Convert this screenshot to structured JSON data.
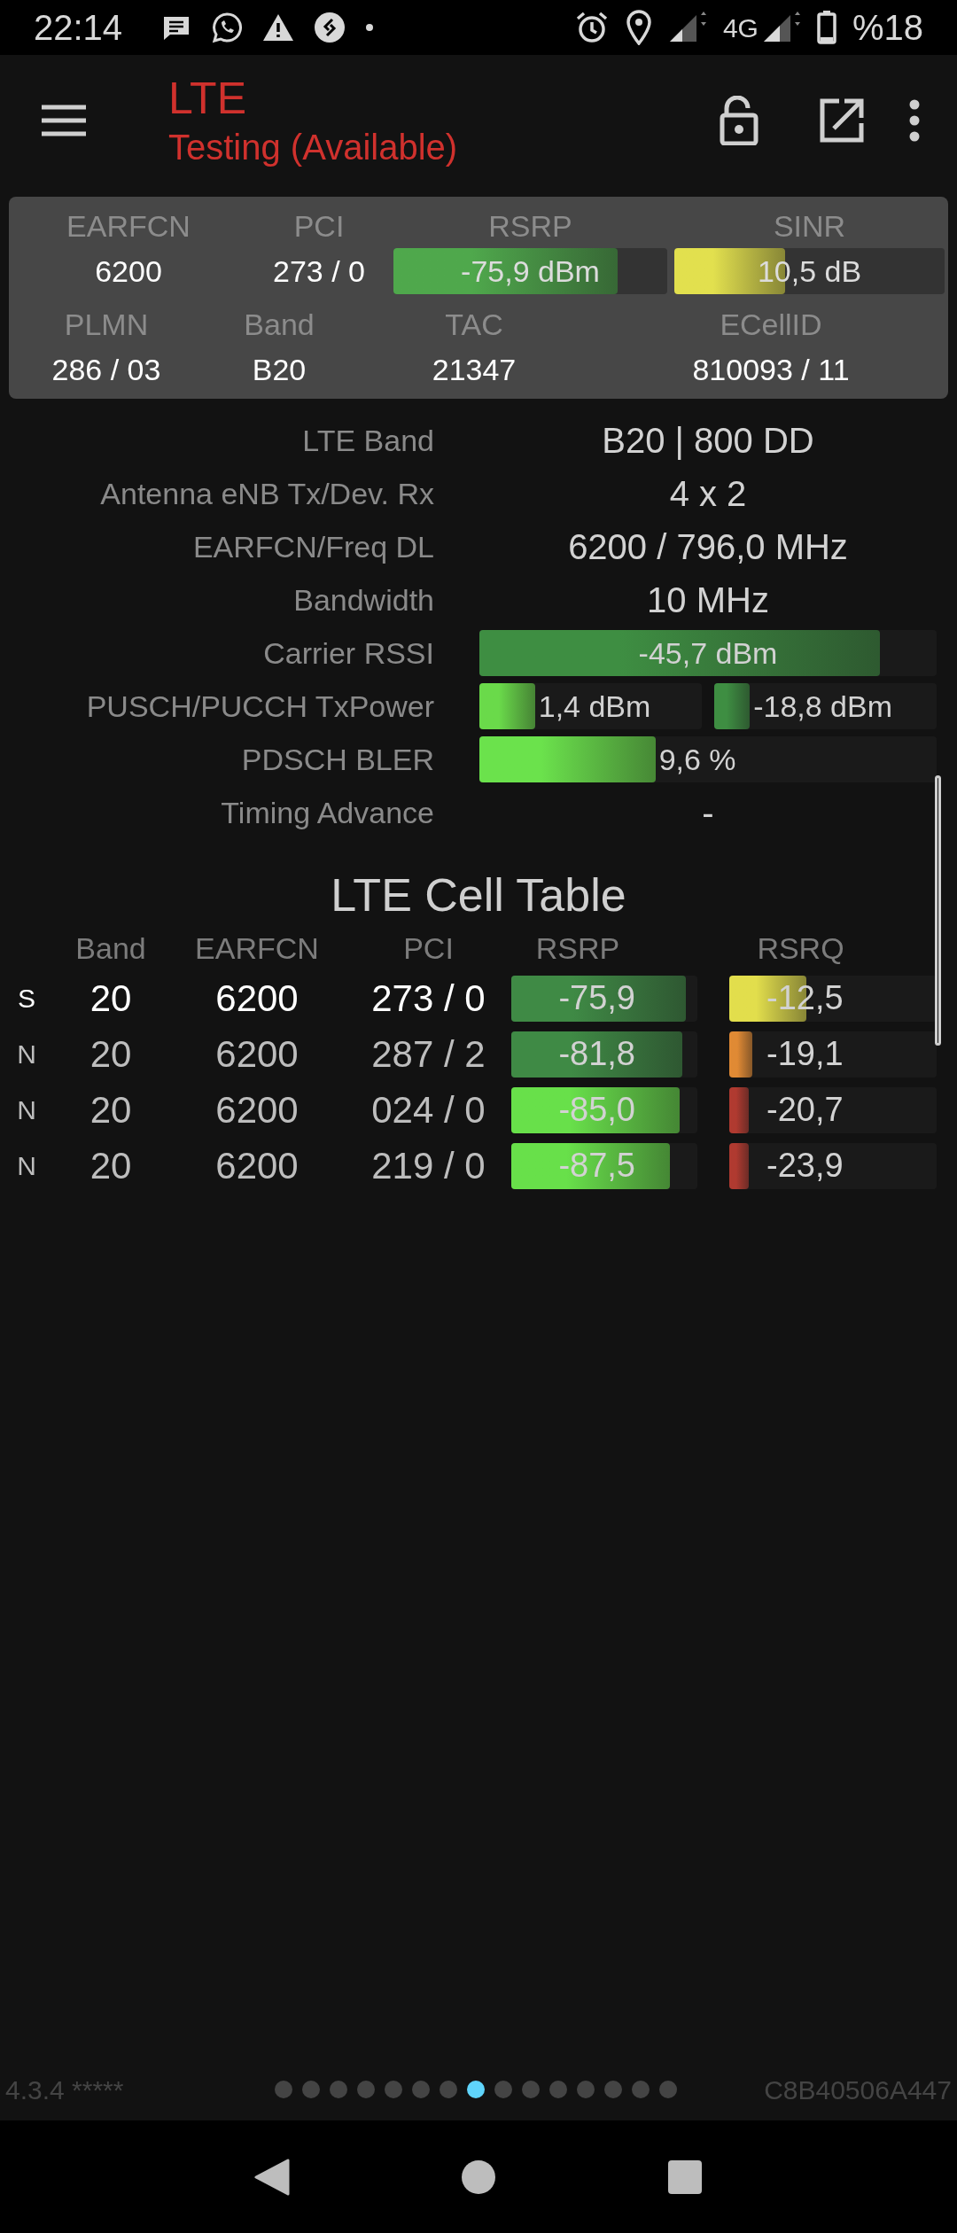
{
  "status_bar": {
    "time": "22:14",
    "network": "4G",
    "battery": "%18"
  },
  "app_bar": {
    "title": "LTE",
    "subtitle": "Testing (Available)"
  },
  "summary": {
    "row1": [
      {
        "label": "EARFCN",
        "value": "6200",
        "kind": "text"
      },
      {
        "label": "PCI",
        "value": "273 / 0",
        "kind": "text"
      },
      {
        "label": "RSRP",
        "value": "-75,9 dBm",
        "kind": "bar",
        "level": 0.82,
        "color": "#4fa84c"
      },
      {
        "label": "SINR",
        "value": "10,5 dB",
        "kind": "bar",
        "level": 0.41,
        "color": "#e2e04e"
      }
    ],
    "row2": [
      {
        "label": "PLMN",
        "value": "286 / 03"
      },
      {
        "label": "Band",
        "value": "B20"
      },
      {
        "label": "TAC",
        "value": "21347"
      },
      {
        "label": "ECellID",
        "value": "810093 / 11"
      }
    ]
  },
  "details": [
    {
      "label": "LTE Band",
      "kind": "text",
      "value": "B20 | 800 DD"
    },
    {
      "label": "Antenna eNB Tx/Dev. Rx",
      "kind": "text",
      "value": "4 x 2"
    },
    {
      "label": "EARFCN/Freq DL",
      "kind": "text",
      "value": "6200 / 796,0 MHz"
    },
    {
      "label": "Bandwidth",
      "kind": "text",
      "value": "10 MHz"
    },
    {
      "label": "Carrier RSSI",
      "kind": "bars",
      "bars": [
        {
          "value": "-45,7 dBm",
          "level": 0.876,
          "color": "#3e8e42",
          "kind": "centered"
        }
      ]
    },
    {
      "label": "PUSCH/PUCCH TxPower",
      "kind": "bars",
      "bars": [
        {
          "value": "1,4 dBm",
          "level": 0.25,
          "color": "#6ada4a",
          "kind": "trailing"
        },
        {
          "value": "-18,8 dBm",
          "level": 0.16,
          "color": "#3e8e42",
          "kind": "trailing"
        }
      ]
    },
    {
      "label": "PDSCH BLER",
      "kind": "bars",
      "bars": [
        {
          "value": "9,6 %",
          "level": 0.385,
          "color": "#6be24c",
          "kind": "trailing"
        }
      ]
    },
    {
      "label": "Timing Advance",
      "kind": "text",
      "value": "-"
    }
  ],
  "cell_table": {
    "title": "LTE Cell Table",
    "columns": [
      "Band",
      "EARFCN",
      "PCI",
      "RSRP",
      "RSRQ"
    ],
    "rows": [
      {
        "type": "S",
        "highlighted": true,
        "band": "20",
        "earfcn": "6200",
        "pci": "273 / 0",
        "rsrp": {
          "value": "-75,9",
          "level": 0.94,
          "color": "#3f8a45"
        },
        "rsrq": {
          "value": "-12,5",
          "level": 0.37,
          "color": "#e2de4c"
        }
      },
      {
        "type": "N",
        "highlighted": false,
        "band": "20",
        "earfcn": "6200",
        "pci": "287 / 2",
        "rsrp": {
          "value": "-81,8",
          "level": 0.92,
          "color": "#3f8a45"
        },
        "rsrq": {
          "value": "-19,1",
          "level": 0.11,
          "color": "#e08a34"
        }
      },
      {
        "type": "N",
        "highlighted": false,
        "band": "20",
        "earfcn": "6200",
        "pci": "024 / 0",
        "rsrp": {
          "value": "-85,0",
          "level": 0.905,
          "color": "#68e04a"
        },
        "rsrq": {
          "value": "-20,7",
          "level": 0.07,
          "color": "#b03a30"
        }
      },
      {
        "type": "N",
        "highlighted": false,
        "band": "20",
        "earfcn": "6200",
        "pci": "219 / 0",
        "rsrp": {
          "value": "-87,5",
          "level": 0.85,
          "color": "#68e04a"
        },
        "rsrq": {
          "value": "-23,9",
          "level": 0.04,
          "color": "#b03a30"
        }
      }
    ]
  },
  "footer": {
    "version": "4.3.4 *****",
    "device_id": "C8B40506A447",
    "pages": [
      {
        "selected": false
      },
      {
        "selected": false
      },
      {
        "selected": false
      },
      {
        "selected": false
      },
      {
        "selected": false
      },
      {
        "selected": false
      },
      {
        "selected": false
      },
      {
        "selected": true
      },
      {
        "selected": false
      },
      {
        "selected": false
      },
      {
        "selected": false
      },
      {
        "selected": false
      },
      {
        "selected": false
      },
      {
        "selected": false
      },
      {
        "selected": false
      }
    ]
  }
}
